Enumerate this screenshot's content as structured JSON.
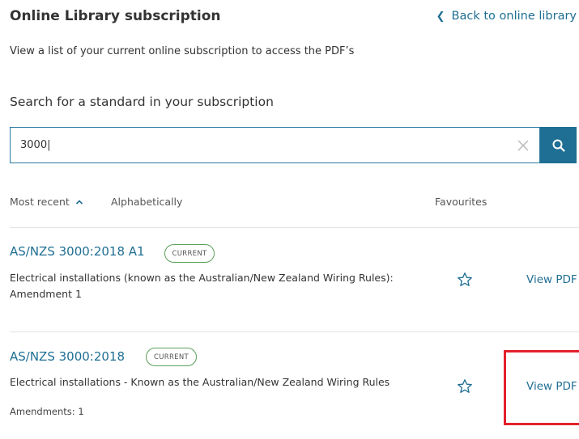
{
  "header": {
    "title": "Online Library subscription",
    "back_link": "Back to online library"
  },
  "subtitle": "View a list of your current online subscription to access the PDF’s",
  "search": {
    "heading": "Search for a standard in your subscription",
    "value": "3000|"
  },
  "sort": {
    "most_recent": "Most recent",
    "alphabetically": "Alphabetically",
    "favourites": "Favourites"
  },
  "results": [
    {
      "title": "AS/NZS 3000:2018 A1",
      "badge": "CURRENT",
      "description_line1": "Electrical installations (known as the Australian/New Zealand Wiring Rules):",
      "description_line2": "Amendment 1",
      "action": "View PDF"
    },
    {
      "title": "AS/NZS 3000:2018",
      "badge": "CURRENT",
      "description_line1": "Electrical installations - Known as the Australian/New Zealand Wiring Rules",
      "amendments": "Amendments: 1",
      "action": "View PDF"
    }
  ],
  "colors": {
    "accent": "#1f6e93",
    "badge_border": "#5aa05a",
    "highlight": "#e3212b"
  }
}
